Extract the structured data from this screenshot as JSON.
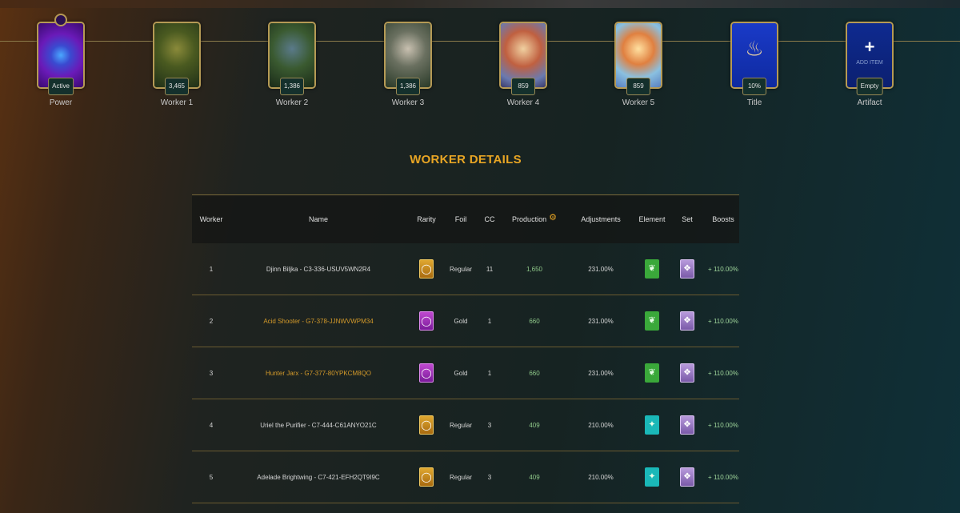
{
  "slots": [
    {
      "label": "Power",
      "badge": "Active",
      "art": "power-crystal"
    },
    {
      "label": "Worker 1",
      "badge": "3,465",
      "art": "djinn-card"
    },
    {
      "label": "Worker 2",
      "badge": "1,386",
      "art": "acid-shooter-card"
    },
    {
      "label": "Worker 3",
      "badge": "1,386",
      "art": "hunter-card"
    },
    {
      "label": "Worker 4",
      "badge": "859",
      "art": "uriel-card"
    },
    {
      "label": "Worker 5",
      "badge": "859",
      "art": "adelade-card"
    },
    {
      "label": "Title",
      "badge": "10%",
      "art": "flame-title"
    },
    {
      "label": "Artifact",
      "badge": "Empty",
      "add_text": "ADD ITEM",
      "add_symbol": "+"
    }
  ],
  "section_title": "WORKER DETAILS",
  "table": {
    "headers": {
      "worker": "Worker",
      "name": "Name",
      "rarity": "Rarity",
      "foil": "Foil",
      "cc": "CC",
      "production": "Production",
      "adjustments": "Adjustments",
      "element": "Element",
      "set": "Set",
      "boosts": "Boosts"
    },
    "rows": [
      {
        "worker": "1",
        "name": "Djinn Biljka - C3-336-USUV5WN2R4",
        "rarity": "common",
        "foil": "Regular",
        "cc": "11",
        "production": "1,650",
        "adjustments": "231.00%",
        "element": "earth",
        "set": "set-icon",
        "boosts": "+ 110.00%"
      },
      {
        "worker": "2",
        "name": "Acid Shooter - G7-378-JJNWVWPM34",
        "rarity": "epic",
        "foil": "Gold",
        "cc": "1",
        "production": "660",
        "adjustments": "231.00%",
        "element": "earth",
        "set": "set-icon",
        "boosts": "+ 110.00%"
      },
      {
        "worker": "3",
        "name": "Hunter Jarx - G7-377-80YPKCM8QO",
        "rarity": "epic",
        "foil": "Gold",
        "cc": "1",
        "production": "660",
        "adjustments": "231.00%",
        "element": "earth",
        "set": "set-icon",
        "boosts": "+ 110.00%"
      },
      {
        "worker": "4",
        "name": "Uriel the Purifier - C7-444-C61ANYO21C",
        "rarity": "common",
        "foil": "Regular",
        "cc": "3",
        "production": "409",
        "adjustments": "210.00%",
        "element": "life",
        "set": "set-icon",
        "boosts": "+ 110.00%"
      },
      {
        "worker": "5",
        "name": "Adelade Brightwing - C7-421-EFH2QT9I9C",
        "rarity": "common",
        "foil": "Regular",
        "cc": "3",
        "production": "409",
        "adjustments": "210.00%",
        "element": "life",
        "set": "set-icon",
        "boosts": "+ 110.00%"
      }
    ]
  },
  "colors": {
    "accent": "#e8a524",
    "gold_name": "#d49a2a",
    "production": "#8fc98a",
    "border": "#b59a55"
  }
}
